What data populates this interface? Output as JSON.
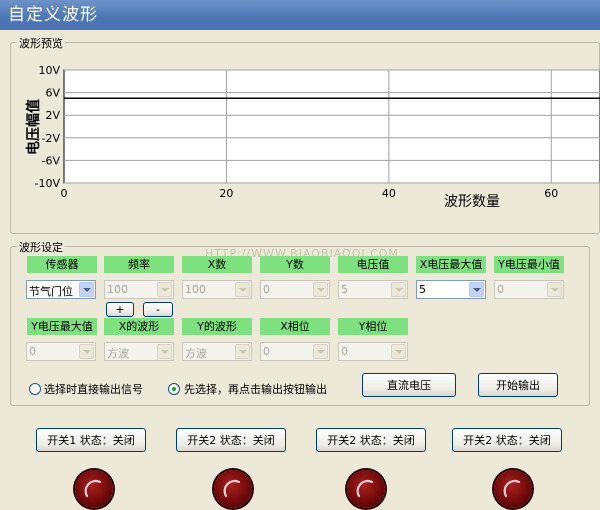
{
  "window": {
    "title": "自定义波形"
  },
  "preview": {
    "group_label": "波形预览",
    "y_axis_label": "电压幅值",
    "x_axis_label": "波形数量"
  },
  "chart_data": {
    "type": "line",
    "xlabel": "波形数量",
    "ylabel": "电压幅值",
    "x_ticks": [
      "0",
      "20",
      "40",
      "60"
    ],
    "y_ticks": [
      "10V",
      "6V",
      "2V",
      "-2V",
      "-6V",
      "-10V"
    ],
    "xlim": [
      0,
      66
    ],
    "ylim": [
      -10,
      10
    ],
    "grid": true,
    "series": [
      {
        "x": [
          0,
          66
        ],
        "y": [
          5,
          5
        ]
      }
    ]
  },
  "settings": {
    "group_label": "波形设定",
    "row1_headers": [
      "传感器",
      "频率",
      "X数",
      "Y数",
      "电压值",
      "X电压最大值",
      "Y电压最小值"
    ],
    "row1_values": [
      "节气门位",
      "100",
      "100",
      "0",
      "5",
      "5",
      "0"
    ],
    "plus_label": "+",
    "minus_label": "-",
    "row2_headers": [
      "Y电压最大值",
      "X的波形",
      "Y的波形",
      "X相位",
      "Y相位"
    ],
    "row2_values": [
      "0",
      "方波",
      "方波",
      "0",
      "0"
    ],
    "radio1_label": "选择时直接输出信号",
    "radio2_label": "先选择，再点击输出按钮输出",
    "dc_button": "直流电压",
    "start_button": "开始输出"
  },
  "switches": [
    {
      "label": "开关1 状态：关闭"
    },
    {
      "label": "开关2 状态：关闭"
    },
    {
      "label": "开关2 状态：关闭"
    },
    {
      "label": "开关2 状态：关闭"
    }
  ],
  "watermark": "HTTP://WWW.BIAOBIAOOI.COM",
  "colors": {
    "header_green": "#7fe07f",
    "title_blue": "#4d76b5",
    "knob_red": "#8b0d0d"
  }
}
